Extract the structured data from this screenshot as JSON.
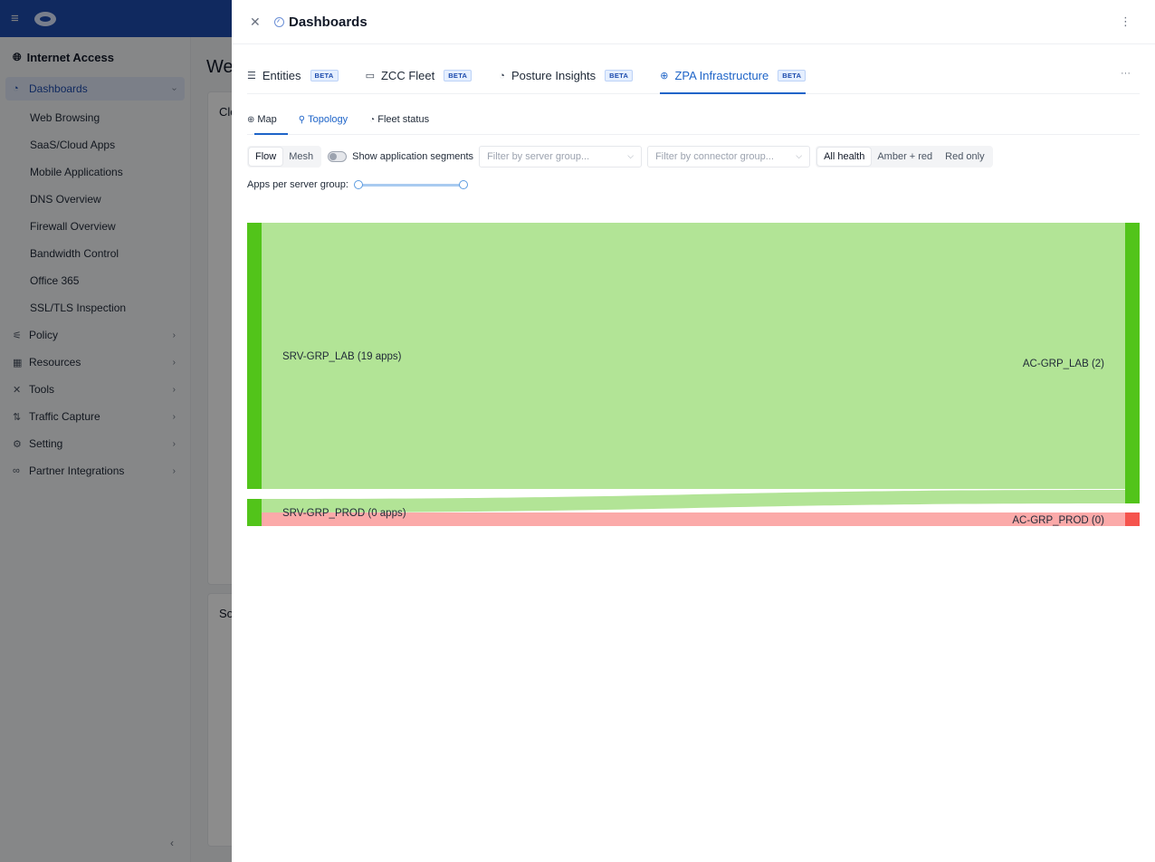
{
  "background": {
    "sidebar": {
      "app_title": "Internet Access",
      "active_item": "Dashboards",
      "sub_items": [
        "Web Browsing",
        "SaaS/Cloud Apps",
        "Mobile Applications",
        "DNS Overview",
        "Firewall Overview",
        "Bandwidth Control",
        "Office 365",
        "SSL/TLS Inspection"
      ],
      "items": [
        "Policy",
        "Resources",
        "Tools",
        "Traffic Capture",
        "Setting",
        "Partner Integrations"
      ]
    },
    "main": {
      "title_partial": "We",
      "card1_title_partial": "Clo",
      "card2_title_partial": "So"
    }
  },
  "drawer": {
    "title": "Dashboards",
    "tabs": [
      {
        "label": "Entities",
        "badge": "BETA",
        "icon": "list-icon"
      },
      {
        "label": "ZCC Fleet",
        "badge": "BETA",
        "icon": "monitor-icon"
      },
      {
        "label": "Posture Insights",
        "badge": "BETA",
        "icon": "gauge-icon"
      },
      {
        "label": "ZPA Infrastructure",
        "badge": "BETA",
        "icon": "globe-icon",
        "active": true
      }
    ],
    "subtabs": [
      {
        "label": "Map",
        "icon": "globe-icon"
      },
      {
        "label": "Topology",
        "icon": "topology-icon",
        "active": true
      },
      {
        "label": "Fleet status",
        "icon": "gauge-icon"
      }
    ],
    "view_modes": [
      "Flow",
      "Mesh"
    ],
    "selected_view": "Flow",
    "show_segments_label": "Show application segments",
    "show_segments_enabled": false,
    "server_group_filter_placeholder": "Filter by server group...",
    "connector_group_filter_placeholder": "Filter by connector group...",
    "health_filters": [
      "All health",
      "Amber + red",
      "Red only"
    ],
    "selected_health": "All health",
    "apps_slider_label": "Apps per server group:",
    "apps_slider_range": [
      0,
      1
    ]
  },
  "chart_data": {
    "type": "sankey",
    "sources": [
      {
        "label": "SRV-GRP_LAB (19 apps)",
        "name": "SRV-GRP_LAB",
        "apps": 19
      },
      {
        "label": "SRV-GRP_PROD (0 apps)",
        "name": "SRV-GRP_PROD",
        "apps": 0
      }
    ],
    "targets": [
      {
        "label": "AC-GRP_LAB (2)",
        "name": "AC-GRP_LAB",
        "count": 2,
        "health": "green"
      },
      {
        "label": "AC-GRP_PROD (0)",
        "name": "AC-GRP_PROD",
        "count": 0,
        "health": "red"
      }
    ],
    "links": [
      {
        "source": 0,
        "target": 0,
        "value": 19,
        "health": "green"
      },
      {
        "source": 1,
        "target": 0,
        "value": 1,
        "health": "green"
      },
      {
        "source": 1,
        "target": 1,
        "value": 1,
        "health": "red"
      }
    ],
    "colors": {
      "green_node": "#52c41a",
      "green_link": "#b2e496",
      "red_node": "#f5544d",
      "red_link": "#fbaaa9"
    }
  }
}
